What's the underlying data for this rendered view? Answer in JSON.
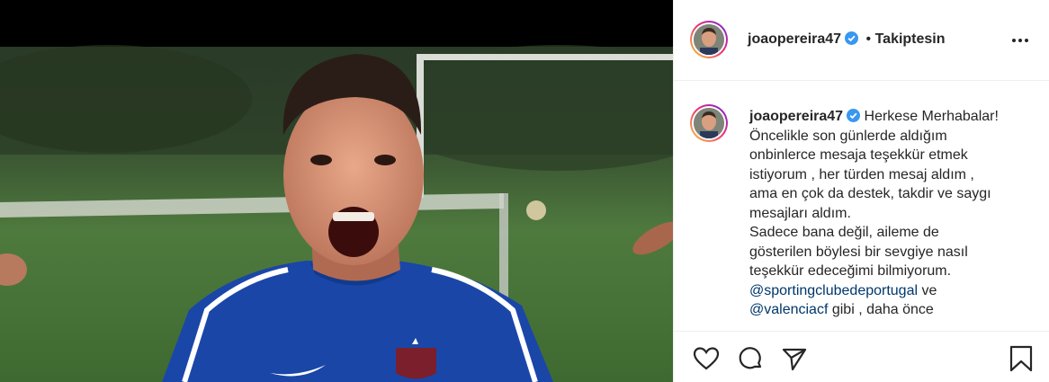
{
  "post": {
    "username": "joaopereira47",
    "follow_sep": "•",
    "follow_status": "Takiptesin",
    "more_icon": "more-options-icon"
  },
  "caption": {
    "username": "joaopereira47",
    "lines": [
      "Herkese Merhabalar!",
      "Öncelikle son günlerde aldığım",
      "onbinlerce mesaja teşekkür etmek",
      "istiyorum , her türden mesaj aldım ,",
      "ama en çok da destek, takdir ve saygı",
      "mesajları aldım.",
      "Sadece bana değil, aileme de",
      "gösterilen böylesi bir sevgiye nasıl",
      "teşekkür edeceğimi bilmiyorum."
    ],
    "mention1": "@sportingclubedeportugal",
    "after_mention1": "ve",
    "mention2": "@valenciacf",
    "after_mention2": "gibi , daha önce"
  },
  "actions": [
    "heart-icon",
    "comment-icon",
    "share-icon",
    "save-icon"
  ],
  "colors": {
    "link": "#00376b",
    "verified": "#3897f0",
    "jersey": "#1a46a8"
  }
}
